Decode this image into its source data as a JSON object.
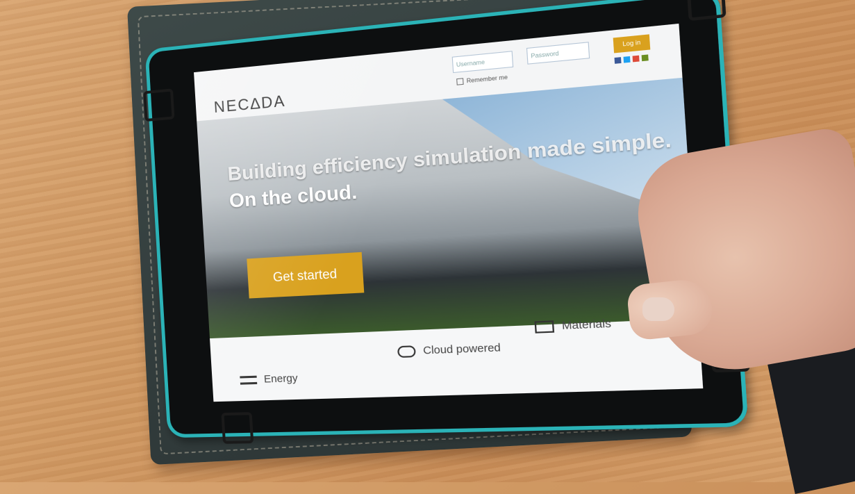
{
  "site": {
    "brand": "NEC∆DA",
    "username_placeholder": "Username",
    "password_placeholder": "Password",
    "login_label": "Log in",
    "remember_label": "Remember me",
    "headline_line1": "Building efficiency simulation made simple.",
    "headline_line2": "On the cloud.",
    "cta_label": "Get started",
    "features": [
      {
        "label": "Energy",
        "icon": "energy-icon"
      },
      {
        "label": "Cloud powered",
        "icon": "cloud-icon"
      },
      {
        "label": "Materials",
        "icon": "materials-icon"
      }
    ]
  },
  "colors": {
    "accent": "#d9a11e",
    "tablet_trim": "#2bb3b7",
    "case": "#3a4545",
    "table": "#d39d66"
  }
}
